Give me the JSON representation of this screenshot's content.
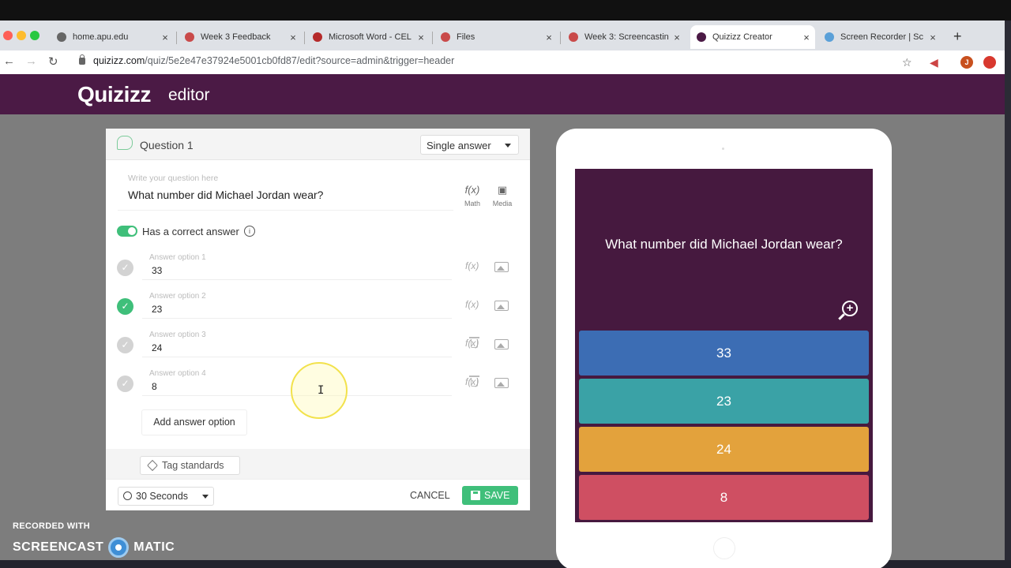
{
  "browser": {
    "tabs": [
      {
        "label": "home.apu.edu",
        "color": "#666666"
      },
      {
        "label": "Week 3 Feedback",
        "color": "#c94a4a"
      },
      {
        "label": "Microsoft Word - CEL",
        "color": "#b52a2a"
      },
      {
        "label": "Files",
        "color": "#c94a4a"
      },
      {
        "label": "Week 3: Screencastin",
        "color": "#c94a4a"
      },
      {
        "label": "Quizizz Creator",
        "color": "#4b1a45"
      },
      {
        "label": "Screen Recorder | Sc",
        "color": "#5aa0d8"
      }
    ],
    "tab_close": "×",
    "new_tab": "+",
    "url_domain": "quizizz.com",
    "url_path": "/quiz/5e2e47e37924e5001cb0fd87/edit?source=admin&trigger=header",
    "avatar_letter": "J"
  },
  "header": {
    "logo": "Quizizz",
    "subtitle": "editor"
  },
  "editor": {
    "question_label": "Question 1",
    "answer_type": "Single answer",
    "question_placeholder": "Write your question here",
    "question_text": "What number did Michael Jordan wear?",
    "math_label": "Math",
    "media_label": "Media",
    "math_glyph": "f(x)",
    "correct_toggle_label": "Has a correct answer",
    "info_glyph": "i",
    "options": [
      {
        "placeholder": "Answer option 1",
        "value": "33",
        "correct": false
      },
      {
        "placeholder": "Answer option 2",
        "value": "23",
        "correct": true
      },
      {
        "placeholder": "Answer option 3",
        "value": "24",
        "correct": false
      },
      {
        "placeholder": "Answer option 4",
        "value": "8",
        "correct": false
      }
    ],
    "check_glyph": "✓",
    "add_option": "Add answer option",
    "tag_standards": "Tag standards",
    "timer": "30 Seconds",
    "cancel": "CANCEL",
    "save": "SAVE"
  },
  "preview": {
    "question": "What number did Michael Jordan wear?",
    "zoom_glyph": "+",
    "answers": [
      {
        "label": "33",
        "color": "#3c6db4"
      },
      {
        "label": "23",
        "color": "#3aa2a6"
      },
      {
        "label": "24",
        "color": "#e3a23c"
      },
      {
        "label": "8",
        "color": "#cf4f62"
      }
    ]
  },
  "watermark": {
    "line1": "RECORDED WITH",
    "left": "SCREENCAST",
    "right": "MATIC"
  },
  "cursor_glyph": "I"
}
